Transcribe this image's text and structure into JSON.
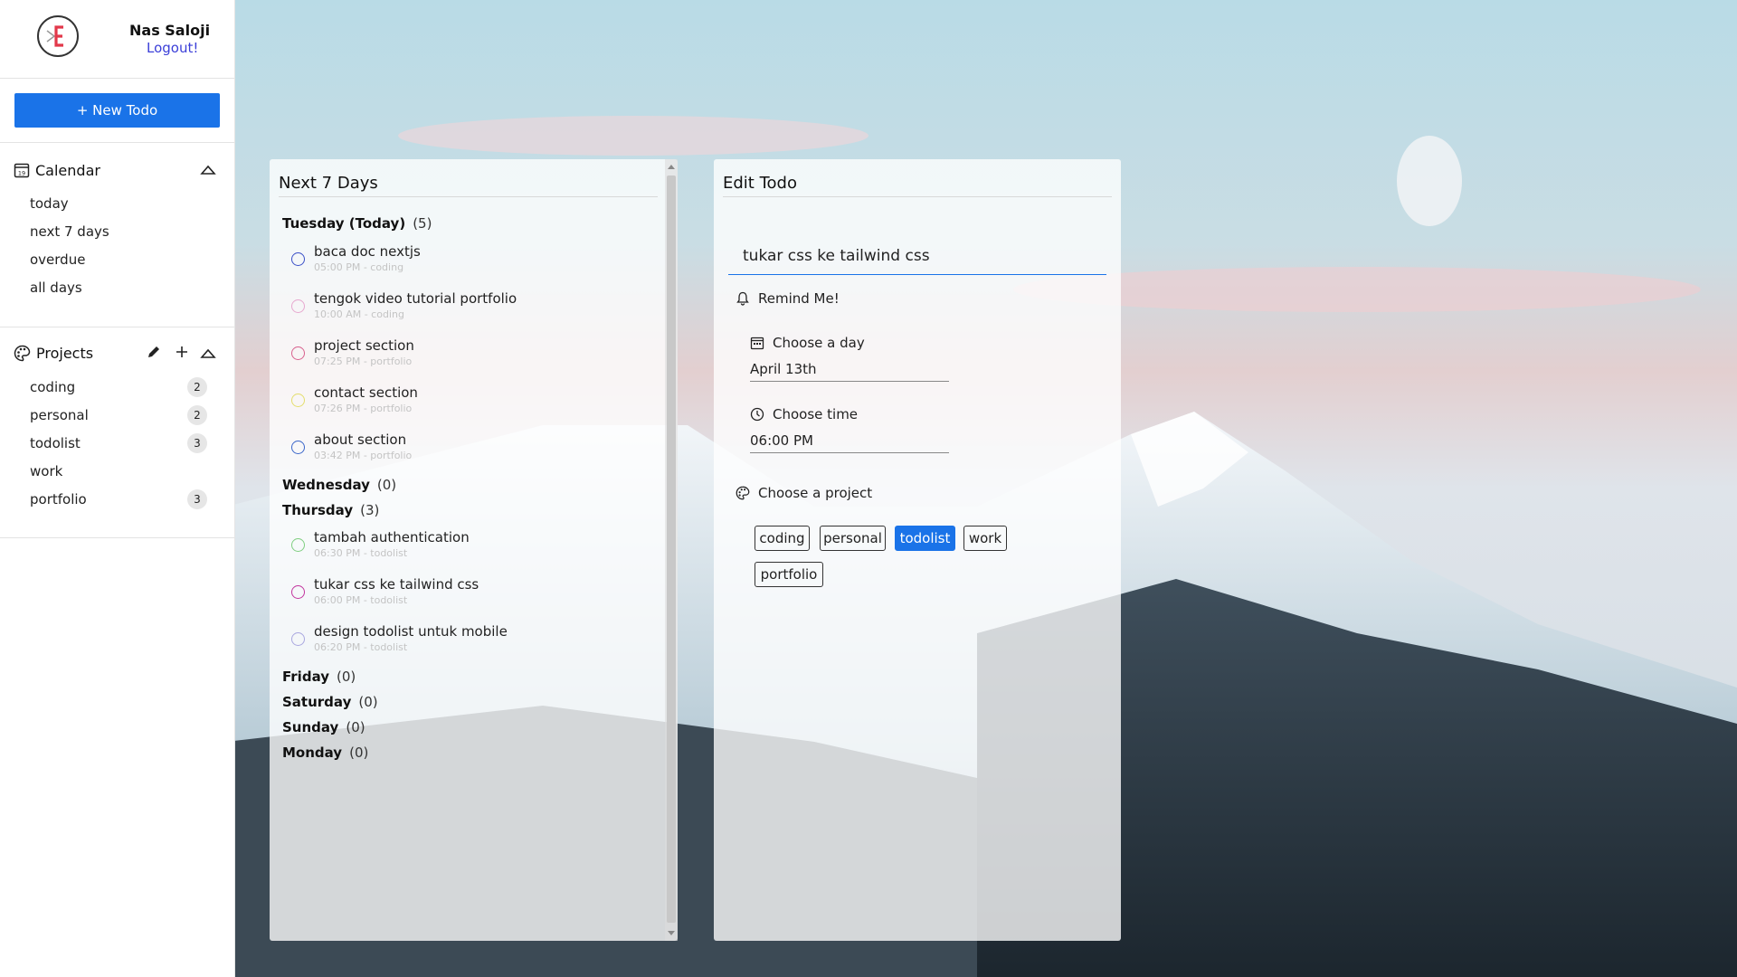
{
  "user": {
    "name": "Nas Saloji",
    "logout_label": "Logout!"
  },
  "new_todo_label": "+ New Todo",
  "calendar": {
    "title": "Calendar",
    "items": [
      "today",
      "next 7 days",
      "overdue",
      "all days"
    ]
  },
  "projects": {
    "title": "Projects",
    "items": [
      {
        "name": "coding",
        "count": "2"
      },
      {
        "name": "personal",
        "count": "2"
      },
      {
        "name": "todolist",
        "count": "3"
      },
      {
        "name": "work",
        "count": ""
      },
      {
        "name": "portfolio",
        "count": "3"
      }
    ]
  },
  "list_panel": {
    "title": "Next 7 Days",
    "days": [
      {
        "name": "Tuesday (Today)",
        "count": "(5)",
        "todos": [
          {
            "title": "baca doc nextjs",
            "meta": "05:00 PM - coding",
            "color": "#3a4fc7"
          },
          {
            "title": "tengok video tutorial portfolio",
            "meta": "10:00 AM - coding",
            "color": "#e7a8cf"
          },
          {
            "title": "project section",
            "meta": "07:25 PM - portfolio",
            "color": "#d8618e"
          },
          {
            "title": "contact section",
            "meta": "07:26 PM - portfolio",
            "color": "#e4de6d"
          },
          {
            "title": "about section",
            "meta": "03:42 PM - portfolio",
            "color": "#3a66c9"
          }
        ]
      },
      {
        "name": "Wednesday",
        "count": "(0)",
        "todos": []
      },
      {
        "name": "Thursday",
        "count": "(3)",
        "todos": [
          {
            "title": "tambah authentication",
            "meta": "06:30 PM - todolist",
            "color": "#7fce80"
          },
          {
            "title": "tukar css ke tailwind css",
            "meta": "06:00 PM - todolist",
            "color": "#c2359e"
          },
          {
            "title": "design todolist untuk mobile",
            "meta": "06:20 PM - todolist",
            "color": "#a9a7e0"
          }
        ]
      },
      {
        "name": "Friday",
        "count": "(0)",
        "todos": []
      },
      {
        "name": "Saturday",
        "count": "(0)",
        "todos": []
      },
      {
        "name": "Sunday",
        "count": "(0)",
        "todos": []
      },
      {
        "name": "Monday",
        "count": "(0)",
        "todos": []
      }
    ]
  },
  "edit_panel": {
    "title": "Edit Todo",
    "todo_text": "tukar css ke tailwind css",
    "remind_label": "Remind Me!",
    "day_label": "Choose a day",
    "day_value": "April 13th",
    "time_label": "Choose time",
    "time_value": "06:00 PM",
    "project_label": "Choose a project",
    "project_tags": [
      "coding",
      "personal",
      "todolist",
      "work",
      "portfolio"
    ],
    "selected_project": "todolist"
  },
  "colors": {
    "accent": "#1a73e8",
    "logout": "#3b3fd8"
  }
}
